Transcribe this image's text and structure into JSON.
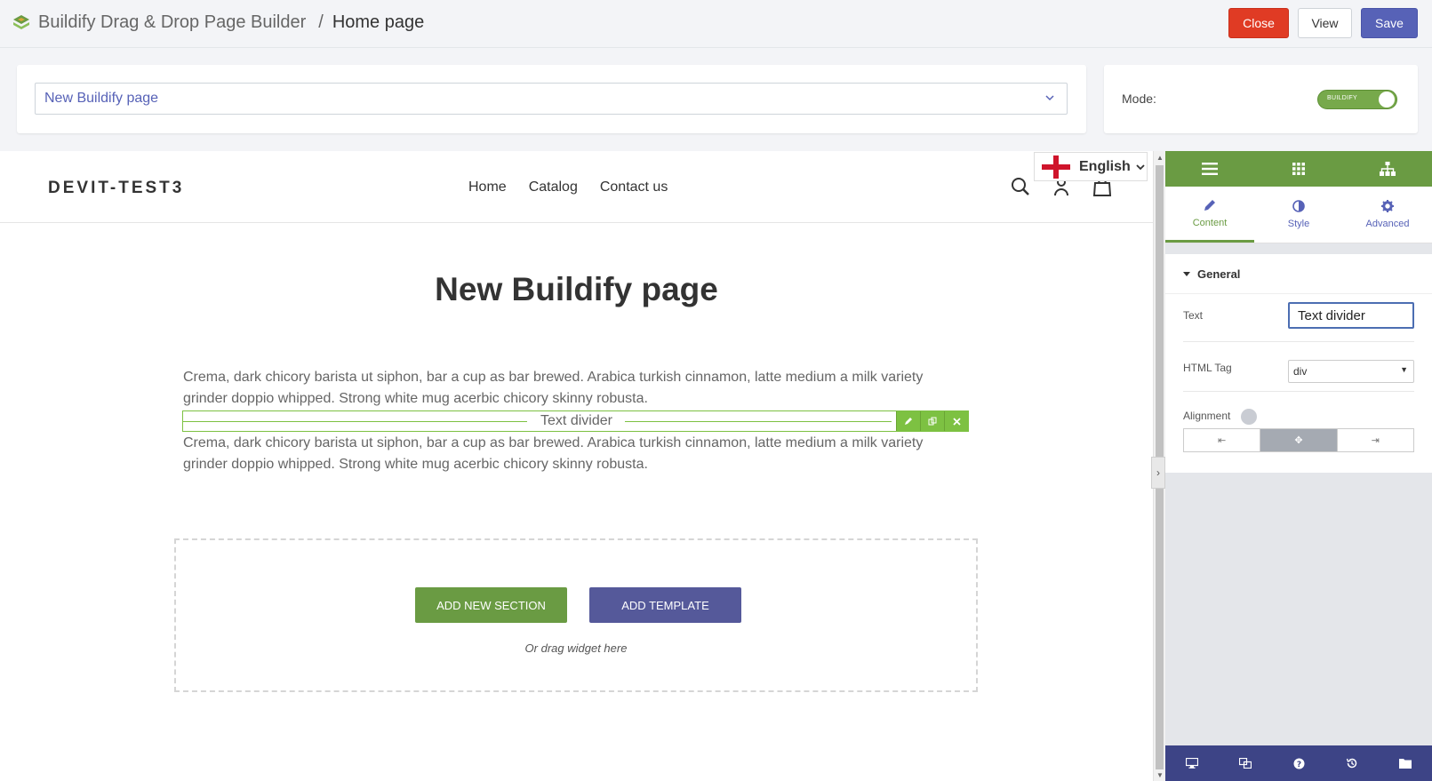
{
  "app": {
    "title": "Buildify Drag & Drop Page Builder",
    "separator": "/",
    "current_page": "Home page"
  },
  "toolbar": {
    "close_label": "Close",
    "view_label": "View",
    "save_label": "Save",
    "close_color": "#e03b24",
    "save_color": "#5762b7"
  },
  "page_selector": {
    "selected": "New Buildify page"
  },
  "mode": {
    "label": "Mode:",
    "toggle_text": "BUILDIFY",
    "enabled": true
  },
  "site": {
    "brand": "DEVIT-TEST3",
    "nav": [
      "Home",
      "Catalog",
      "Contact us"
    ],
    "language": "English"
  },
  "content": {
    "page_title": "New Buildify page",
    "paragraph1": "Crema, dark chicory barista ut siphon, bar a cup as bar brewed. Arabica turkish cinnamon, latte medium a milk variety grinder doppio whipped. Strong white mug acerbic chicory skinny robusta.",
    "divider_text": "Text divider",
    "paragraph2": "Crema, dark chicory barista ut siphon, bar a cup as bar brewed. Arabica turkish cinnamon, latte medium a milk variety grinder doppio whipped. Strong white mug acerbic chicory skinny robusta."
  },
  "dropzone": {
    "add_section_label": "ADD NEW SECTION",
    "add_template_label": "ADD TEMPLATE",
    "hint": "Or drag widget here"
  },
  "editor": {
    "tabs": [
      {
        "label": "Content",
        "icon": "pencil-icon",
        "active": true
      },
      {
        "label": "Style",
        "icon": "half-circle-icon",
        "active": false
      },
      {
        "label": "Advanced",
        "icon": "gear-icon",
        "active": false
      }
    ],
    "section_title": "General",
    "text_label": "Text",
    "text_value": "Text divider",
    "html_tag_label": "HTML Tag",
    "html_tag_value": "div",
    "alignment_label": "Alignment",
    "alignment_selected": "center",
    "accent_color": "#6a9b43",
    "footer_color": "#3d4486"
  }
}
